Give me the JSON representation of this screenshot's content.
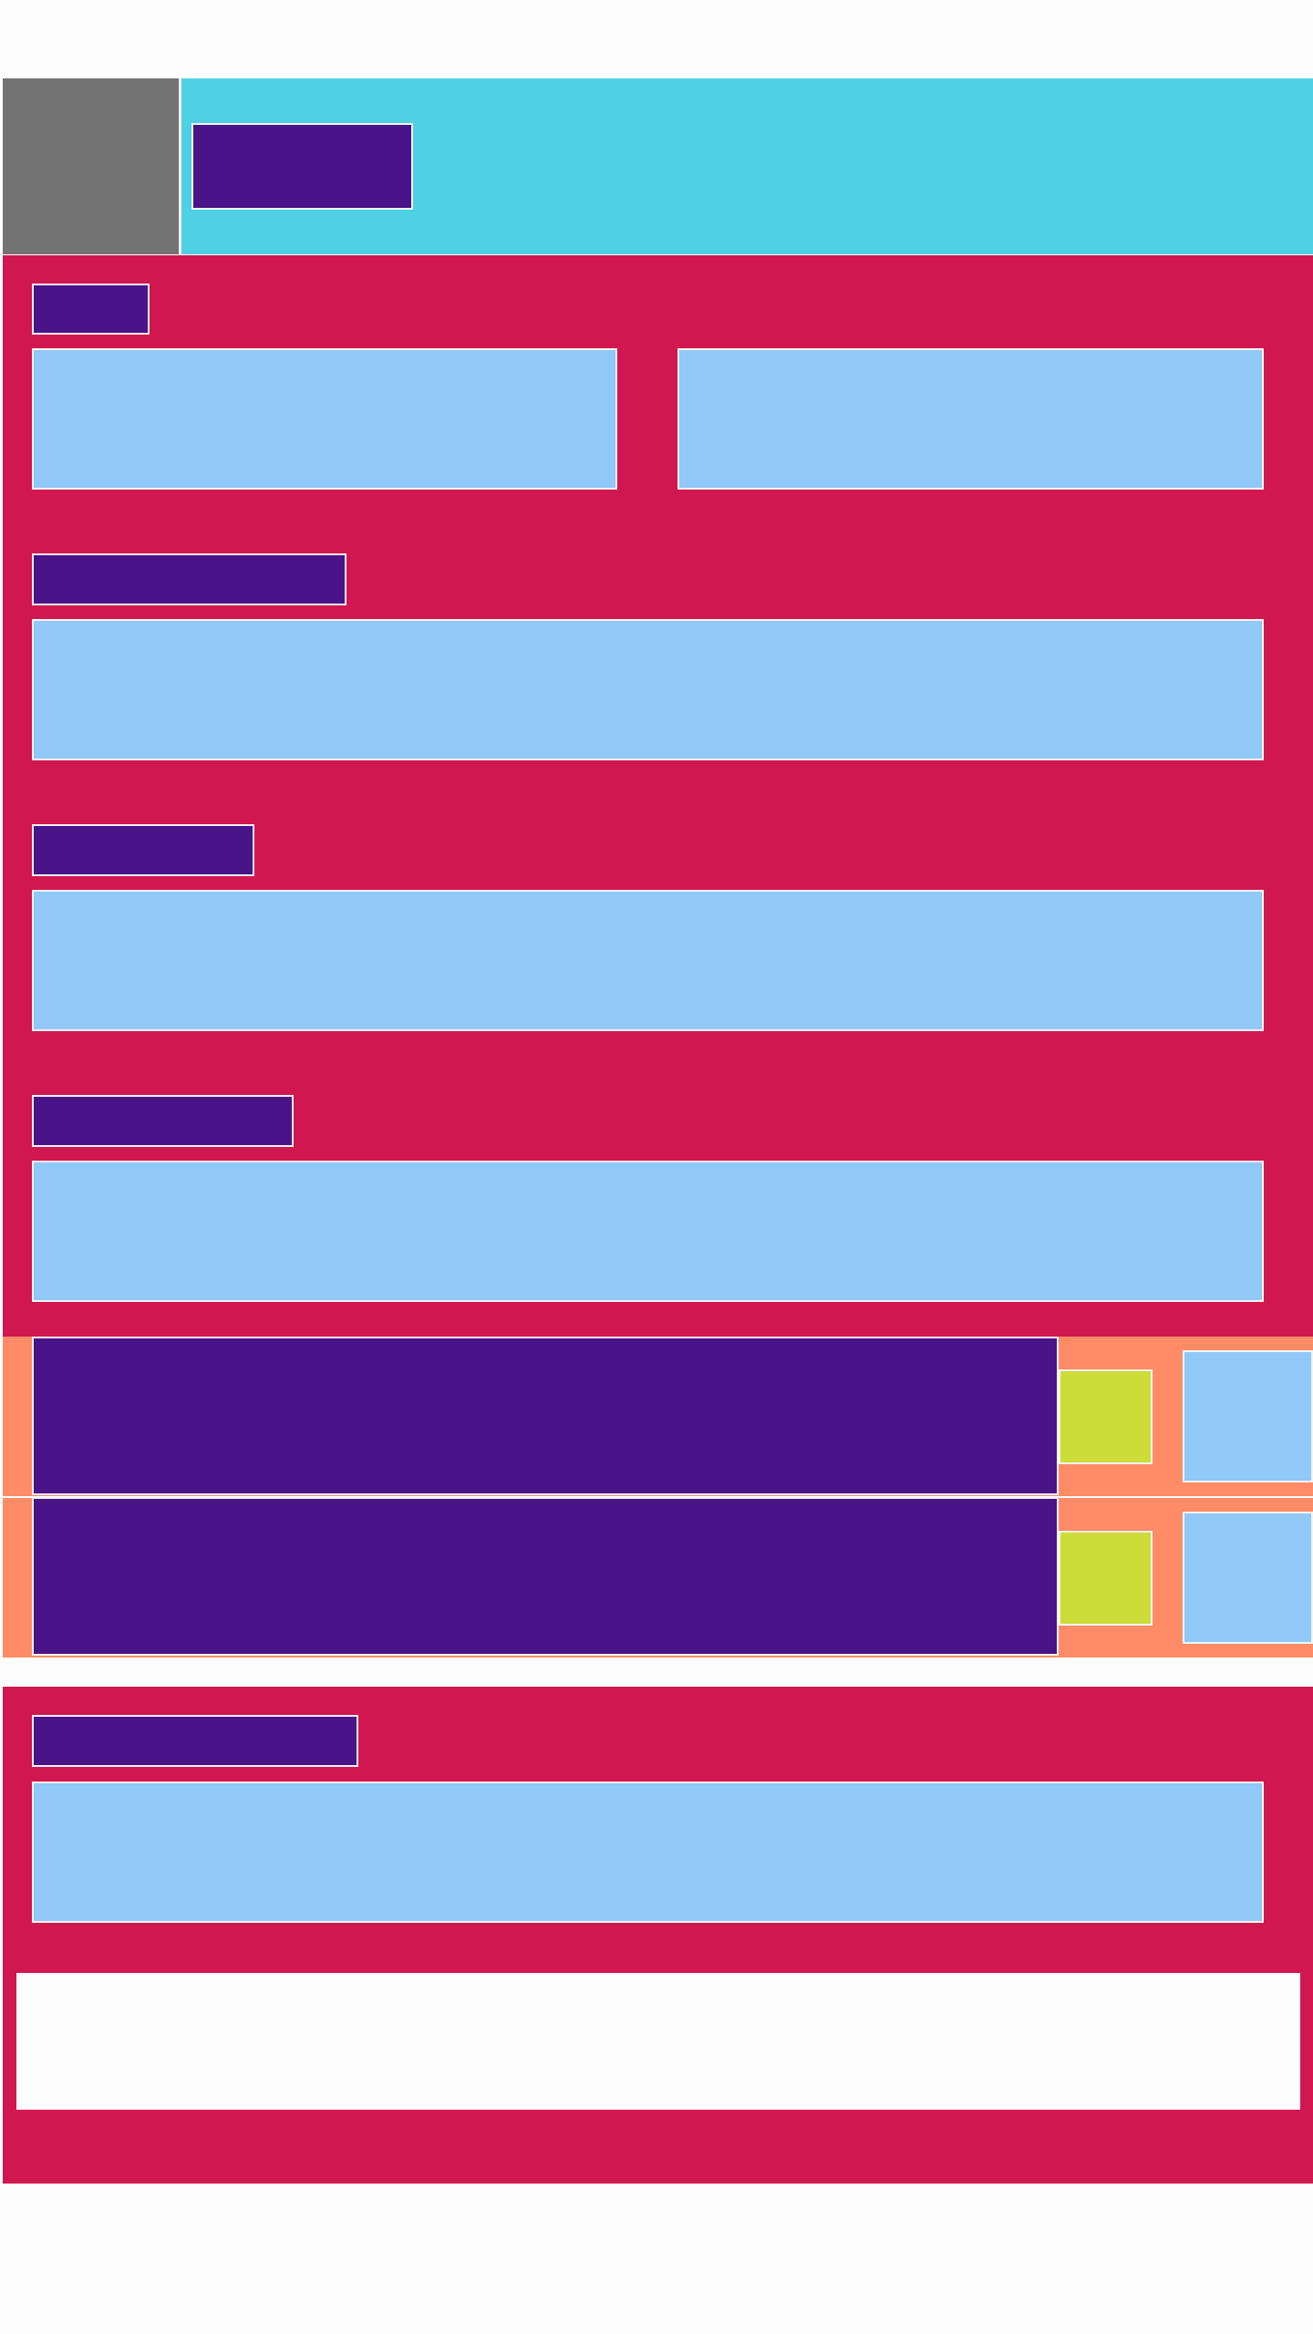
{
  "header": {
    "back_label": "",
    "title": ""
  },
  "form": {
    "section_label": "",
    "fields": [
      {
        "label": "",
        "value": "",
        "placeholder": ""
      },
      {
        "label": "",
        "value": "",
        "placeholder": ""
      },
      {
        "label": "",
        "value": "",
        "placeholder": ""
      },
      {
        "label": "",
        "value": "",
        "placeholder": ""
      },
      {
        "label": "",
        "value": "",
        "placeholder": ""
      },
      {
        "label": "",
        "value": "",
        "placeholder": ""
      }
    ]
  },
  "list": {
    "rows": [
      {
        "title": "",
        "checked": false,
        "action_label": ""
      },
      {
        "title": "",
        "checked": false,
        "action_label": ""
      }
    ]
  },
  "submit": {
    "label": ""
  },
  "colors": {
    "header_back": "#737373",
    "header_bar": "#4fd0e4",
    "form_bg": "#d1174f",
    "chip": "#4a1489",
    "field": "#90c8f7",
    "row_band": "#ff8c66",
    "checkbox": "#cddc39",
    "submit_bg": "#fdfdfd"
  }
}
